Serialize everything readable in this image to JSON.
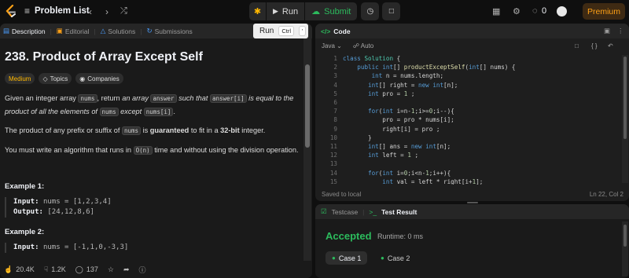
{
  "topbar": {
    "problem_list_label": "Problem List",
    "run_label": "Run",
    "submit_label": "Submit",
    "notification_count": "0",
    "premium_label": "Premium"
  },
  "tooltip": {
    "label": "Run",
    "shortcut_key": "Ctrl",
    "shortcut_extra": "'"
  },
  "description_tabs": [
    {
      "label": "Description"
    },
    {
      "label": "Editorial"
    },
    {
      "label": "Solutions"
    },
    {
      "label": "Submissions"
    }
  ],
  "problem": {
    "title": "238. Product of Array Except Self",
    "difficulty": "Medium",
    "topics_label": "Topics",
    "companies_label": "Companies",
    "p1": {
      "a": "Given an integer array ",
      "code1": "nums",
      "b": ", return ",
      "c": "an array",
      "code2": "answer",
      "d": " such that ",
      "code3": "answer[i]",
      "e": " is equal to the product of all the elements of ",
      "code4": "nums",
      "f": " except ",
      "code5": "nums[i]",
      "g": "."
    },
    "p2": {
      "a": "The product of any prefix or suffix of ",
      "code1": "nums",
      "b": " is ",
      "c": "guaranteed",
      "d": " to fit in a ",
      "e": "32-bit",
      "f": " integer."
    },
    "p3": {
      "a": "You must write an algorithm that runs in ",
      "code1": "O(n)",
      "b": " time and without using the division operation."
    },
    "example1": {
      "title": "Example 1:",
      "input_label": "Input:",
      "input_value": "nums = [1,2,3,4]",
      "output_label": "Output:",
      "output_value": "[24,12,8,6]"
    },
    "example2": {
      "title": "Example 2:",
      "input_label": "Input:",
      "input_value": "nums = [-1,1,0,-3,3]"
    }
  },
  "footer": {
    "likes": "20.4K",
    "dislikes": "1.2K",
    "comments": "137"
  },
  "code_panel": {
    "title": "Code",
    "language": "Java",
    "mode": "Auto",
    "line_numbers": [
      "1",
      "2",
      "3",
      "4",
      "5",
      "6",
      "7",
      "8",
      "9",
      "10",
      "11",
      "12",
      "13",
      "14",
      "15"
    ],
    "saved_status": "Saved to local",
    "cursor_position": "Ln 22, Col 2"
  },
  "result_panel": {
    "testcase_tab": "Testcase",
    "result_tab": "Test Result",
    "status": "Accepted",
    "runtime": "Runtime: 0 ms",
    "cases": [
      {
        "label": "Case 1"
      },
      {
        "label": "Case 2"
      }
    ]
  },
  "colors": {
    "accepted_green": "#2cbb5d",
    "medium_yellow": "#ffb800",
    "premium_orange": "#ffa116"
  }
}
